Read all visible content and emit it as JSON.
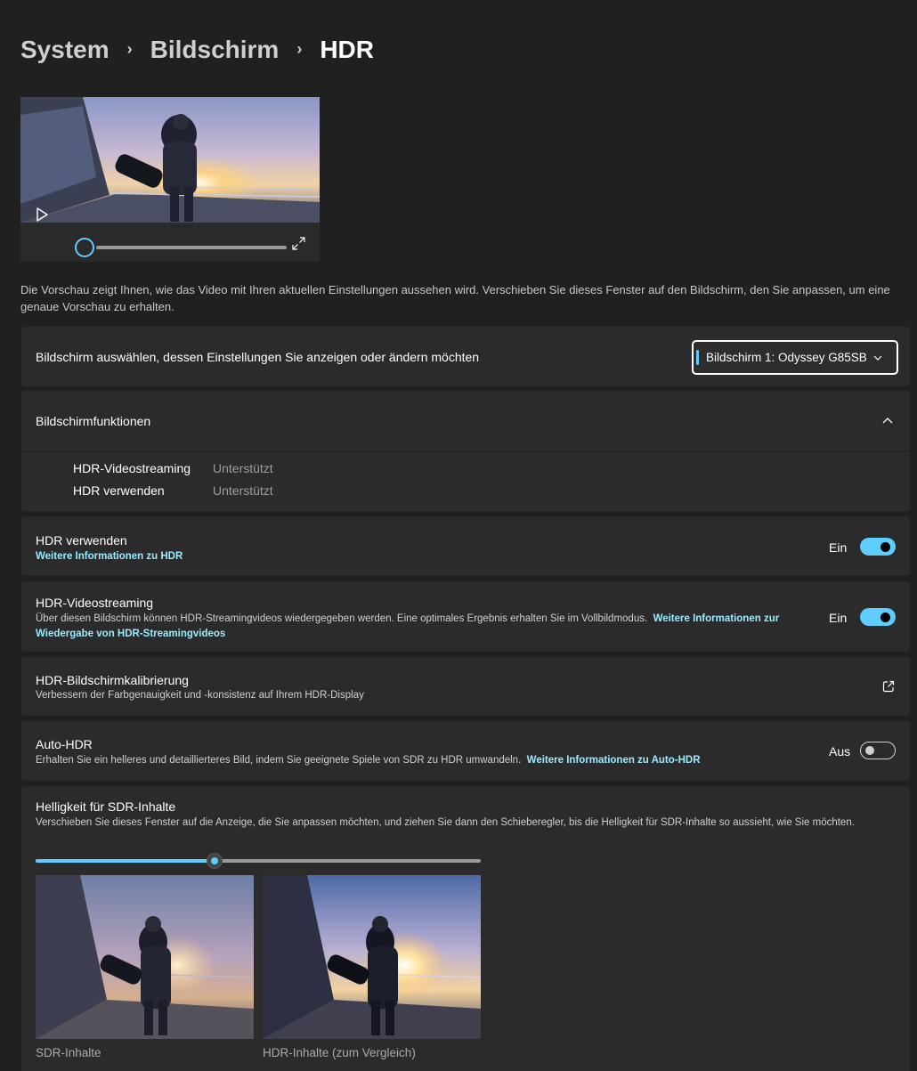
{
  "breadcrumb": {
    "root": "System",
    "parent": "Bildschirm",
    "current": "HDR"
  },
  "preview": {
    "description": "Die Vorschau zeigt Ihnen, wie das Video mit Ihren aktuellen Einstellungen aussehen wird. Verschieben Sie dieses Fenster auf den Bildschirm, den Sie anpassen, um eine genaue Vorschau zu erhalten.",
    "seek_progress": 0.0
  },
  "display_select": {
    "label": "Bildschirm auswählen, dessen Einstellungen Sie anzeigen oder ändern möchten",
    "selected": "Bildschirm 1: Odyssey G85SB"
  },
  "capabilities": {
    "title": "Bildschirmfunktionen",
    "items": [
      {
        "name": "HDR-Videostreaming",
        "value": "Unterstützt"
      },
      {
        "name": "HDR verwenden",
        "value": "Unterstützt"
      }
    ]
  },
  "use_hdr": {
    "title": "HDR verwenden",
    "link": "Weitere Informationen zu HDR",
    "state_label": "Ein"
  },
  "hdr_streaming": {
    "title": "HDR-Videostreaming",
    "desc": "Über diesen Bildschirm können HDR-Streamingvideos wiedergegeben werden. Eine optimales Ergebnis erhalten Sie im Vollbildmodus.",
    "link": "Weitere Informationen zur Wiedergabe von HDR-Streamingvideos",
    "state_label": "Ein"
  },
  "calibration": {
    "title": "HDR-Bildschirmkalibrierung",
    "desc": "Verbessern der Farbgenauigkeit und -konsistenz auf Ihrem HDR-Display"
  },
  "auto_hdr": {
    "title": "Auto-HDR",
    "desc": "Erhalten Sie ein helleres und detaillierteres Bild, indem Sie geeignete Spiele von SDR zu HDR umwandeln.",
    "link": "Weitere Informationen zu Auto-HDR",
    "state_label": "Aus"
  },
  "sdr_brightness": {
    "title": "Helligkeit für SDR-Inhalte",
    "desc": "Verschieben Sie dieses Fenster auf die Anzeige, die Sie anpassen möchten, und ziehen Sie dann den Schieberegler, bis die Helligkeit für SDR-Inhalte so aussieht, wie Sie möchten.",
    "slider_value": 0.41,
    "sdr_caption": "SDR-Inhalte",
    "hdr_caption": "HDR-Inhalte (zum Vergleich)"
  },
  "colors": {
    "accent": "#60cdff",
    "link": "#99ebff",
    "background": "#202020",
    "card": "#2b2b2b"
  }
}
